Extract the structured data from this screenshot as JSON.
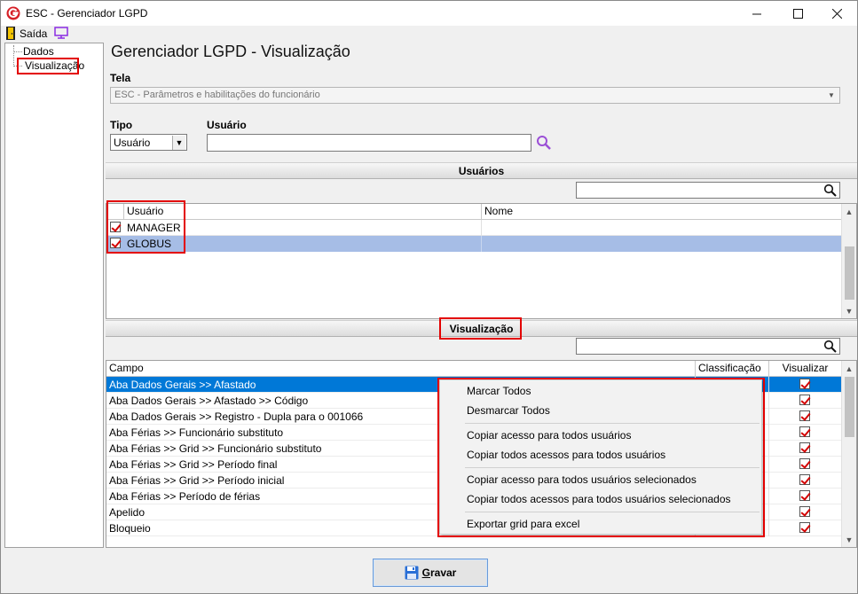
{
  "window": {
    "title": "ESC - Gerenciador LGPD"
  },
  "toolbar": {
    "exit_label": "Saída"
  },
  "tree": {
    "items": [
      "Dados",
      "Visualização"
    ]
  },
  "page": {
    "heading": "Gerenciador LGPD - Visualização"
  },
  "form": {
    "tela_label": "Tela",
    "tela_value": "ESC - Parâmetros e habilitações do funcionário",
    "tipo_label": "Tipo",
    "tipo_value": "Usuário",
    "usuario_label": "Usuário",
    "usuario_value": ""
  },
  "users_section": {
    "title": "Usuários",
    "columns": [
      "Usuário",
      "Nome"
    ],
    "rows": [
      {
        "usuario": "MANAGER",
        "nome": "",
        "checked": true
      },
      {
        "usuario": "GLOBUS",
        "nome": "",
        "checked": true
      }
    ]
  },
  "view_section": {
    "title": "Visualização",
    "columns": [
      "Campo",
      "Classificação",
      "Visualizar"
    ],
    "rows": [
      {
        "campo": "Aba Dados Gerais >> Afastado",
        "classificacao": "",
        "visualizar": true
      },
      {
        "campo": "Aba Dados Gerais >> Afastado >> Código",
        "classificacao": "",
        "visualizar": true
      },
      {
        "campo": "Aba Dados Gerais >> Registro - Dupla para o 001066",
        "classificacao": "",
        "visualizar": true
      },
      {
        "campo": "Aba Férias >> Funcionário substituto",
        "classificacao": "",
        "visualizar": true
      },
      {
        "campo": "Aba Férias >> Grid >> Funcionário substituto",
        "classificacao": "",
        "visualizar": true
      },
      {
        "campo": "Aba Férias >> Grid >> Período final",
        "classificacao": "",
        "visualizar": true
      },
      {
        "campo": "Aba Férias >> Grid >> Período inicial",
        "classificacao": "",
        "visualizar": true
      },
      {
        "campo": "Aba Férias >> Período de férias",
        "classificacao": "",
        "visualizar": true
      },
      {
        "campo": "Apelido",
        "classificacao": "",
        "visualizar": true
      },
      {
        "campo": "Bloqueio",
        "classificacao": "",
        "visualizar": true
      }
    ]
  },
  "context_menu": {
    "items": [
      "Marcar Todos",
      "Desmarcar Todos",
      "Copiar acesso para todos usuários",
      "Copiar todos acessos para todos usuários",
      "Copiar acesso para todos usuários selecionados",
      "Copiar todos acessos para todos usuários selecionados",
      "Exportar grid para excel"
    ]
  },
  "footer": {
    "save_label_first": "G",
    "save_label_rest": "ravar"
  },
  "colors": {
    "highlight_box": "#e30000",
    "selected_row_blue": "#0078d7",
    "selected_row_light": "#a6bde6"
  }
}
